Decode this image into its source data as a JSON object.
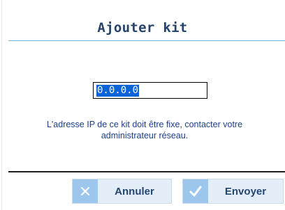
{
  "dialog": {
    "title": "Ajouter kit"
  },
  "ip_field": {
    "value": "0.0.0.0"
  },
  "hint": {
    "line1": "L'adresse IP de ce kit doit être fixe, contacter votre",
    "line2": "administrateur réseau."
  },
  "buttons": {
    "cancel": {
      "label": "Annuler",
      "icon": "close-icon"
    },
    "send": {
      "label": "Envoyer",
      "icon": "check-icon"
    }
  },
  "colors": {
    "title": "#25436b",
    "accent_rule": "#79b6e3",
    "selection": "#0a64d8",
    "hint_text": "#1c3e86",
    "button_bg": "#e3eef9",
    "button_icon_bg": "#9cc6ec",
    "button_text": "#26466f"
  }
}
